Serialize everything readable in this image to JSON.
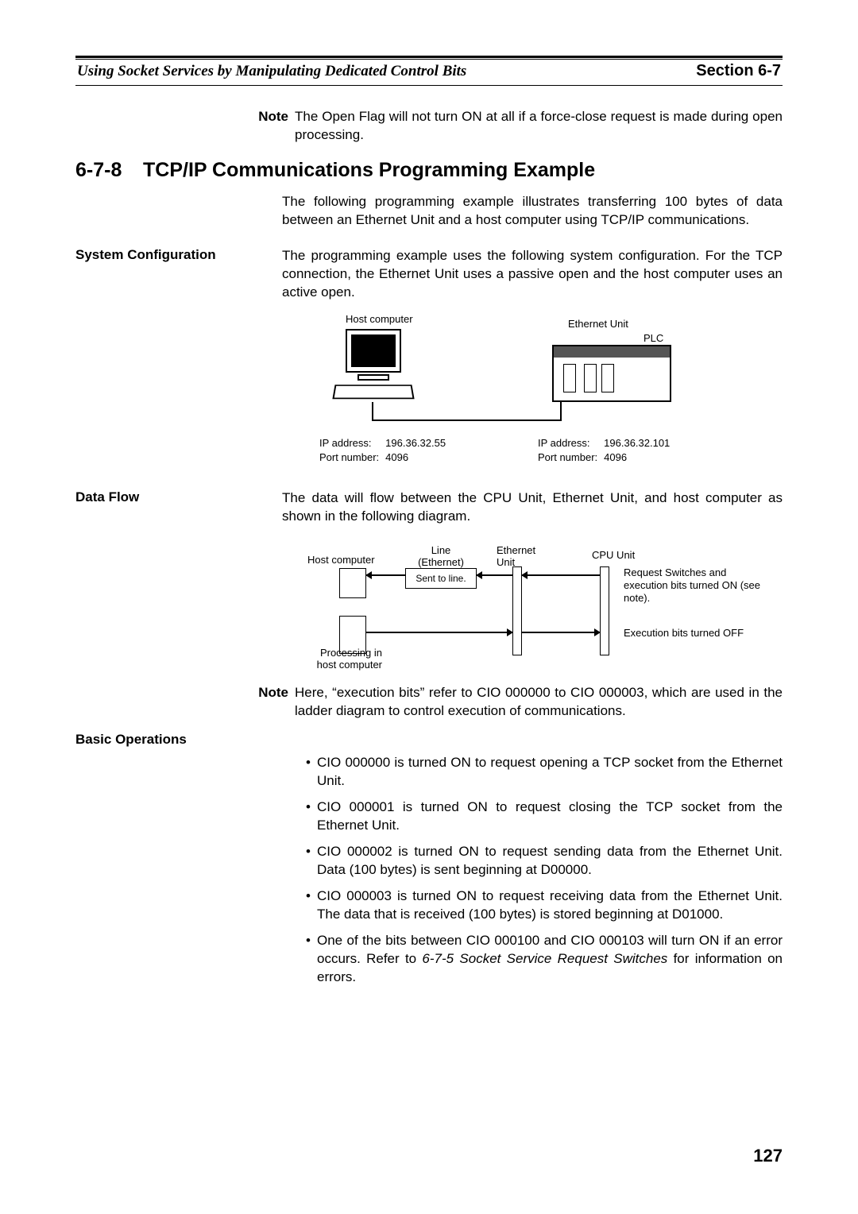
{
  "header": {
    "left": "Using Socket Services by Manipulating Dedicated Control Bits",
    "right": "Section 6-7"
  },
  "top_note": {
    "label": "Note",
    "text": "The Open Flag will not turn ON at all if a force-close request is made during open processing."
  },
  "section": {
    "number": "6-7-8",
    "title": "TCP/IP Communications Programming Example",
    "intro": "The following programming example illustrates transferring 100 bytes of data between an Ethernet Unit and a host computer using TCP/IP communications."
  },
  "sysconf": {
    "heading": "System Configuration",
    "body": "The programming example uses the following system configuration. For the TCP connection, the Ethernet Unit uses a passive open and the host computer uses an active open.",
    "fig": {
      "host_label": "Host computer",
      "unit_label": "Ethernet Unit",
      "plc_label": "PLC",
      "addr_key_ip": "IP address:",
      "addr_key_port": "Port number:",
      "host_ip": "196.36.32.55",
      "host_port": "4096",
      "unit_ip": "196.36.32.101",
      "unit_port": "4096"
    }
  },
  "dataflow": {
    "heading": "Data Flow",
    "body": "The data will flow between the CPU Unit, Ethernet Unit, and host computer as shown in the following diagram.",
    "fig": {
      "host": "Host computer",
      "line": "Line\n(Ethernet)",
      "eth": "Ethernet\nUnit",
      "cpu": "CPU Unit",
      "sent": "Sent to line.",
      "proc": "Processing in\nhost computer",
      "note1": "Request Switches and execution bits turned ON (see note).",
      "note2": "Execution bits turned OFF"
    },
    "note": {
      "label": "Note",
      "text": "Here, “execution bits” refer to CIO 000000 to CIO 000003, which are used in the ladder diagram to control execution of communications."
    }
  },
  "basicops": {
    "heading": "Basic Operations",
    "items": [
      "CIO 000000 is turned ON to request opening a TCP socket from the Ethernet Unit.",
      "CIO 000001 is turned ON to request closing the TCP socket from the Ethernet Unit.",
      "CIO 000002 is turned ON to request sending data from the Ethernet Unit. Data (100 bytes) is sent beginning at D00000.",
      "CIO 000003 is turned ON to request receiving data from the Ethernet Unit. The data that is received (100 bytes) is stored beginning at D01000."
    ],
    "last_item_pre": "One of the bits between CIO 000100 and CIO 000103 will turn ON if an error occurs. Refer to ",
    "last_item_ref": "6-7-5 Socket Service Request Switches",
    "last_item_post": " for information on errors."
  },
  "page_number": "127"
}
